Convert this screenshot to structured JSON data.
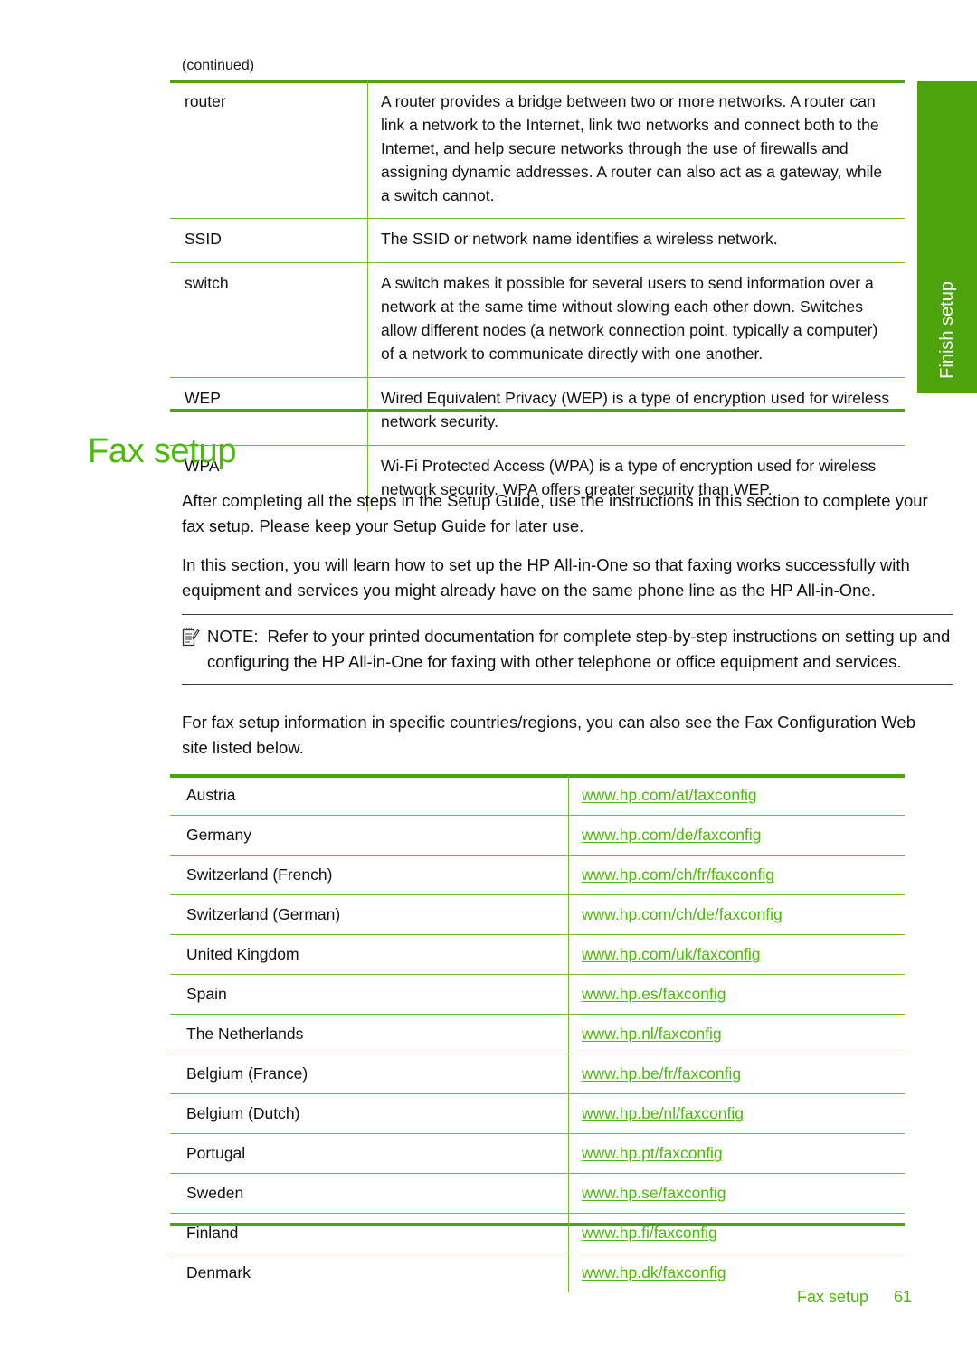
{
  "page": {
    "continued_label": "(continued)",
    "side_tab_label": "Finish setup",
    "accent_green": "#4cba0a",
    "tab_green": "#4ca40a",
    "rule_green": "#6fbe2a"
  },
  "glossary_table": {
    "rows": [
      {
        "term": "router",
        "description": "A router provides a bridge between two or more networks. A router can link a network to the Internet, link two networks and connect both to the Internet, and help secure networks through the use of firewalls and assigning dynamic addresses. A router can also act as a gateway, while a switch cannot."
      },
      {
        "term": "SSID",
        "description": "The SSID or network name identifies a wireless network."
      },
      {
        "term": "switch",
        "description": "A switch makes it possible for several users to send information over a network at the same time without slowing each other down. Switches allow different nodes (a network connection point, typically a computer) of a network to communicate directly with one another."
      },
      {
        "term": "WEP",
        "description": "Wired Equivalent Privacy (WEP) is a type of encryption used for wireless network security."
      },
      {
        "term": "WPA",
        "description": "Wi-Fi Protected Access (WPA) is a type of encryption used for wireless network security. WPA offers greater security than WEP."
      }
    ]
  },
  "heading": "Fax setup",
  "paragraphs": {
    "p1": "After completing all the steps in the Setup Guide, use the instructions in this section to complete your fax setup. Please keep your Setup Guide for later use.",
    "p2": "In this section, you will learn how to set up the HP All-in-One so that faxing works successfully with equipment and services you might already have on the same phone line as the HP All-in-One.",
    "p3": "For fax setup information in specific countries/regions, you can also see the Fax Configuration Web site listed below."
  },
  "note": {
    "label": "NOTE:",
    "text": "Refer to your printed documentation for complete step-by-step instructions on setting up and configuring the HP All-in-One for faxing with other telephone or office equipment and services."
  },
  "country_table": {
    "rows": [
      {
        "country": "Austria",
        "url": "www.hp.com/at/faxconfig"
      },
      {
        "country": "Germany",
        "url": "www.hp.com/de/faxconfig"
      },
      {
        "country": "Switzerland (French)",
        "url": "www.hp.com/ch/fr/faxconfig"
      },
      {
        "country": "Switzerland (German)",
        "url": "www.hp.com/ch/de/faxconfig"
      },
      {
        "country": "United Kingdom",
        "url": "www.hp.com/uk/faxconfig"
      },
      {
        "country": "Spain",
        "url": "www.hp.es/faxconfig"
      },
      {
        "country": "The Netherlands",
        "url": "www.hp.nl/faxconfig"
      },
      {
        "country": "Belgium (France)",
        "url": "www.hp.be/fr/faxconfig"
      },
      {
        "country": "Belgium (Dutch)",
        "url": "www.hp.be/nl/faxconfig"
      },
      {
        "country": "Portugal",
        "url": "www.hp.pt/faxconfig"
      },
      {
        "country": "Sweden",
        "url": "www.hp.se/faxconfig"
      },
      {
        "country": "Finland",
        "url": "www.hp.fi/faxconfig"
      },
      {
        "country": "Denmark",
        "url": "www.hp.dk/faxconfig"
      }
    ]
  },
  "footer": {
    "section": "Fax setup",
    "page_number": "61"
  }
}
